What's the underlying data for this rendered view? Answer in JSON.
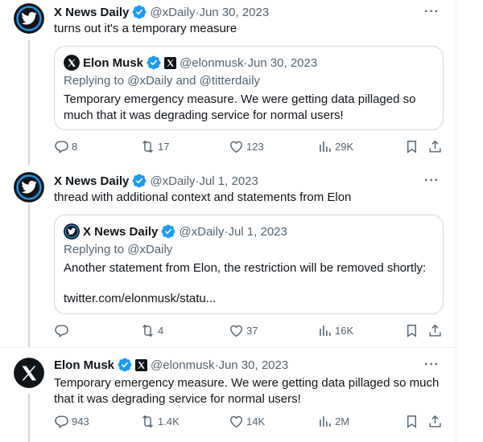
{
  "tweets": [
    {
      "author": "X News Daily",
      "handle": "@xDaily",
      "date": "Jun 30, 2023",
      "text": "turns out it's a temporary measure",
      "quote": {
        "author": "Elon Musk",
        "handle": "@elonmusk",
        "date": "Jun 30, 2023",
        "replying_prefix": "Replying to ",
        "replying_to": "@xDaily and @titterdaily",
        "text": "Temporary emergency measure. We were getting data pillaged so much that it was degrading service for normal users!"
      },
      "stats": {
        "replies": "8",
        "reposts": "17",
        "likes": "123",
        "views": "29K"
      }
    },
    {
      "author": "X News Daily",
      "handle": "@xDaily",
      "date": "Jul 1, 2023",
      "text": "thread with additional context and statements from Elon",
      "quote": {
        "author": "X News Daily",
        "handle": "@xDaily",
        "date": "Jul 1, 2023",
        "replying_prefix": "Replying to ",
        "replying_to": "@xDaily",
        "text": "Another statement from Elon, the restriction will be removed shortly:",
        "link": "twitter.com/elonmusk/statu..."
      },
      "stats": {
        "replies": "",
        "reposts": "4",
        "likes": "37",
        "views": "16K"
      }
    },
    {
      "author": "Elon Musk",
      "handle": "@elonmusk",
      "date": "Jun 30, 2023",
      "text": "Temporary emergency measure. We were getting data pillaged so much that it was degrading service for normal users!",
      "stats": {
        "replies": "943",
        "reposts": "1.4K",
        "likes": "14K",
        "views": "2M"
      }
    }
  ],
  "separator": " · ",
  "more_glyph": "···",
  "colors": {
    "verified": "#1d9bf0",
    "secondary_text": "#536471",
    "border": "#cfd9de"
  },
  "icons": [
    "x-news-avatar-icon",
    "x-logo-avatar-icon",
    "verified-badge-icon",
    "x-affiliate-badge-icon",
    "reply-icon",
    "repost-icon",
    "like-icon",
    "views-icon",
    "bookmark-icon",
    "share-icon",
    "more-icon"
  ]
}
